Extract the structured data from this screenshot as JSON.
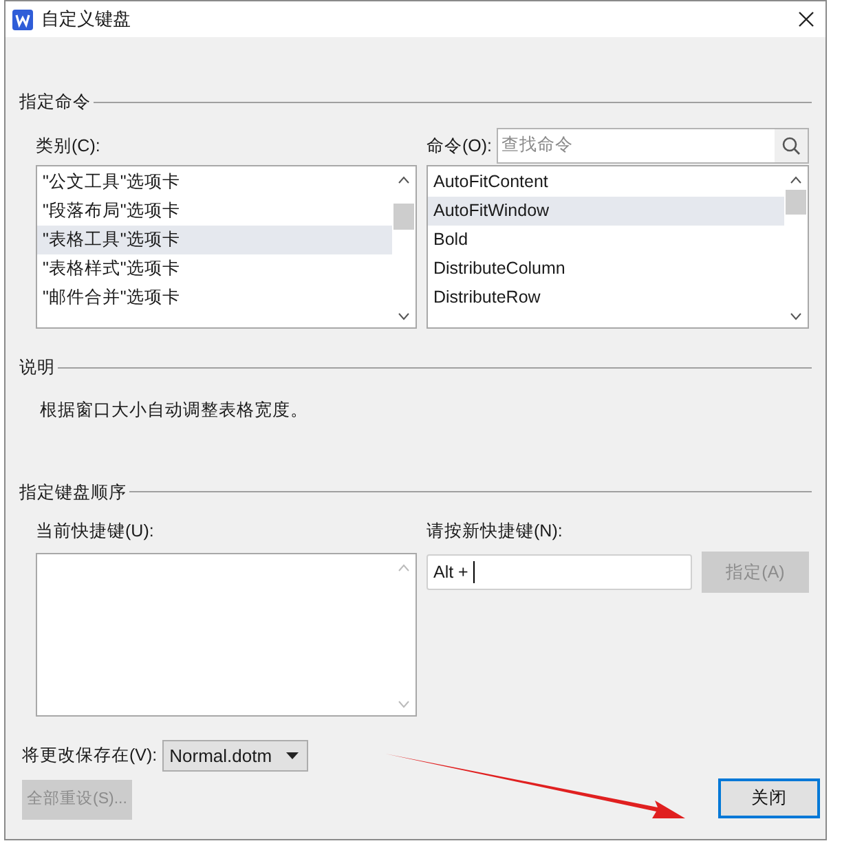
{
  "window": {
    "title": "自定义键盘"
  },
  "assign_command": {
    "heading": "指定命令",
    "categories_label": "类别(C):",
    "commands_label": "命令(O):",
    "search": {
      "placeholder": "查找命令"
    },
    "categories": [
      {
        "text": "\"公文工具\"选项卡",
        "selected": false
      },
      {
        "text": "\"段落布局\"选项卡",
        "selected": false
      },
      {
        "text": "\"表格工具\"选项卡",
        "selected": true
      },
      {
        "text": "\"表格样式\"选项卡",
        "selected": false
      },
      {
        "text": "\"邮件合并\"选项卡",
        "selected": false
      }
    ],
    "commands": [
      {
        "text": "AutoFitContent",
        "selected": false
      },
      {
        "text": "AutoFitWindow",
        "selected": true
      },
      {
        "text": "Bold",
        "selected": false
      },
      {
        "text": "DistributeColumn",
        "selected": false
      },
      {
        "text": "DistributeRow",
        "selected": false
      }
    ]
  },
  "description": {
    "heading": "说明",
    "text": "根据窗口大小自动调整表格宽度。"
  },
  "keyboard_sequence": {
    "heading": "指定键盘顺序",
    "current_label": "当前快捷键(U):",
    "new_label": "请按新快捷键(N):",
    "new_value": "Alt + ",
    "assign_button": {
      "label": "指定(A)",
      "disabled": true
    }
  },
  "save_in": {
    "label": "将更改保存在(V):",
    "value": "Normal.dotm"
  },
  "reset_button": {
    "label": "全部重设(S)...",
    "disabled": true
  },
  "close_button": {
    "label": "关闭",
    "disabled": false
  }
}
